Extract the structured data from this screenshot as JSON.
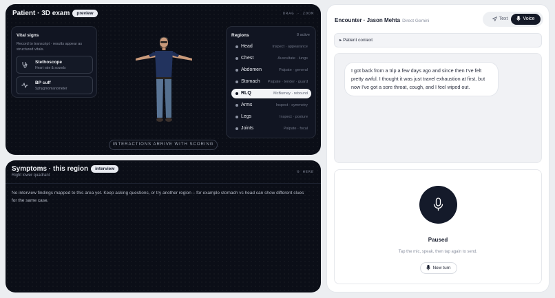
{
  "exam": {
    "title": "Patient · 3D exam",
    "badge": "preview",
    "controls_hint": "DRAG · ZOOM",
    "vitals": {
      "heading": "Vital signs",
      "description": "Record to transcript · results appear as structured vitals.",
      "instruments": [
        {
          "name": "Stethoscope",
          "sub": "Heart rate & sounds",
          "icon": "stethoscope-icon"
        },
        {
          "name": "BP cuff",
          "sub": "Sphygmomanometer",
          "icon": "pulse-icon"
        }
      ]
    },
    "regions": {
      "heading": "Regions",
      "count": "8 active",
      "items": [
        {
          "label": "Head",
          "action": "Inspect · appearance",
          "active": false
        },
        {
          "label": "Chest",
          "action": "Auscultate · lungs",
          "active": false
        },
        {
          "label": "Abdomen",
          "action": "Palpate · general",
          "active": false
        },
        {
          "label": "Stomach",
          "action": "Palpate · tender · guard",
          "active": false
        },
        {
          "label": "RLQ",
          "action": "McBurney · rebound",
          "active": true
        },
        {
          "label": "Arms",
          "action": "Inspect · symmetry",
          "active": false
        },
        {
          "label": "Legs",
          "action": "Inspect · posture",
          "active": false
        },
        {
          "label": "Joints",
          "action": "Palpate · focal",
          "active": false
        }
      ]
    },
    "scoring_note": "INTERACTIONS ARRIVE WITH SCORING"
  },
  "symptoms": {
    "title": "Symptoms · this region",
    "badge": "interview",
    "subtitle": "Right lower quadrant",
    "count_hint": "0 HERE",
    "body": "No interview findings mapped to this area yet. Keep asking questions, or try another region – for example stomach vs head can show different clues for the same case."
  },
  "encounter": {
    "title": "Encounter · Jason Mehta",
    "mode_label": "Direct Gemini",
    "toggle": {
      "text": "Text",
      "voice": "Voice",
      "selected": "Voice"
    },
    "context_label": "▸ Patient context",
    "message": "I got back from a trip a few days ago and since then I've felt pretty awful. I thought it was just travel exhaustion at first, but now I've got a sore throat, cough, and I feel wiped out.",
    "status": "Paused",
    "voice_hint": "Tap the mic, speak, then tap again to send.",
    "new_turn": "New turn"
  },
  "colors": {
    "dark_panel": "#0b0e17",
    "accent_dark": "#141a2a",
    "active_region": "#f3f4f7"
  }
}
